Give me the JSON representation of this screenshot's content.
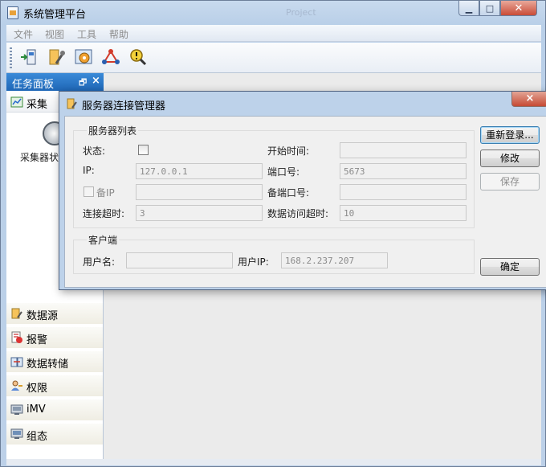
{
  "window": {
    "title": "系统管理平台",
    "ghost_title": "Project"
  },
  "menu": [
    "文件",
    "视图",
    "工具",
    "帮助"
  ],
  "toolbar_icons": [
    "import-icon",
    "settings-icon",
    "config-gear-icon",
    "network-icon",
    "warning-search-icon"
  ],
  "task_panel": {
    "title": "任务面板",
    "pin_glyph": "🗗",
    "close_glyph": "×",
    "top_group": "采集",
    "collector_label": "采集器状",
    "groups": [
      "数据源",
      "报警",
      "数据转储",
      "权限",
      "iMV",
      "组态"
    ]
  },
  "dialog": {
    "title": "服务器连接管理器",
    "close_glyph": "×",
    "server_group": {
      "title": "服务器列表",
      "status_label": "状态:",
      "start_time_label": "开始时间:",
      "start_time_value": "",
      "ip_label": "IP:",
      "ip_value": "127.0.0.1",
      "port_label": "端口号:",
      "port_value": "5673",
      "backup_ip_label": "备IP",
      "backup_ip_value": "",
      "backup_port_label": "备端口号:",
      "backup_port_value": "",
      "conn_timeout_label": "连接超时:",
      "conn_timeout_value": "3",
      "data_timeout_label": "数据访问超时:",
      "data_timeout_value": "10"
    },
    "client_group": {
      "title": "客户端",
      "username_label": "用户名:",
      "username_value": "",
      "user_ip_label": "用户IP:",
      "user_ip_value": "168.2.237.207"
    },
    "buttons": {
      "relogin": "重新登录...",
      "modify": "修改",
      "save": "保存",
      "ok": "确定"
    }
  },
  "colors": {
    "panel_header": "#1f67b7",
    "close_red": "#c94b37"
  }
}
